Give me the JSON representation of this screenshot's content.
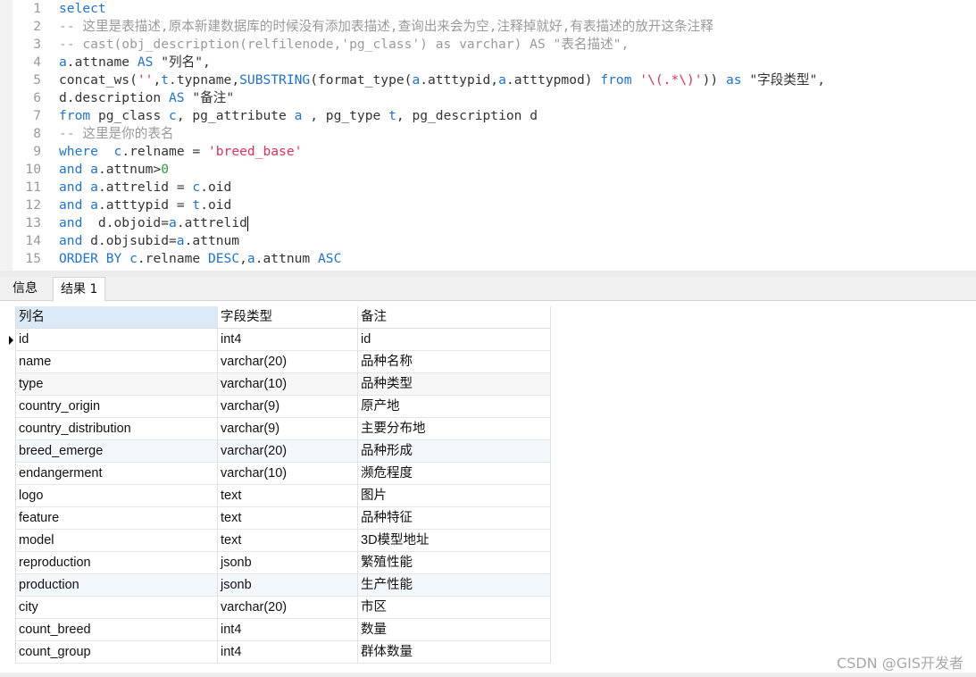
{
  "editor": {
    "lines": [
      [
        [
          "kw",
          "select"
        ]
      ],
      [
        [
          "cm",
          "-- 这里是表描述,原本新建数据库的时候没有添加表描述,查询出来会为空,注释掉就好,有表描述的放开这条注释"
        ]
      ],
      [
        [
          "cm",
          "-- cast(obj_description(relfilenode,'pg_class') as varchar) AS \"表名描述\","
        ]
      ],
      [
        [
          "kw",
          "a"
        ],
        [
          "",
          "."
        ],
        [
          "",
          "attname "
        ],
        [
          "kw",
          "AS"
        ],
        [
          "",
          " \"列名\","
        ]
      ],
      [
        [
          "",
          "concat_ws("
        ],
        [
          "str",
          "''"
        ],
        [
          "",
          ","
        ],
        [
          "kw",
          "t"
        ],
        [
          "",
          ".typname,"
        ],
        [
          "kw",
          "SUBSTRING"
        ],
        [
          "",
          "(format_type("
        ],
        [
          "kw",
          "a"
        ],
        [
          "",
          ".atttypid,"
        ],
        [
          "kw",
          "a"
        ],
        [
          "",
          ".atttypmod) "
        ],
        [
          "kw",
          "from"
        ],
        [
          "",
          " "
        ],
        [
          "str",
          "'\\(.*\\)'"
        ],
        [
          "",
          "))"
        ],
        [
          "",
          " "
        ],
        [
          "kw",
          "as"
        ],
        [
          "",
          " \"字段类型\","
        ]
      ],
      [
        [
          "",
          "d.description "
        ],
        [
          "kw",
          "AS"
        ],
        [
          "",
          " \"备注\""
        ]
      ],
      [
        [
          "kw",
          "from"
        ],
        [
          "",
          " pg_class "
        ],
        [
          "kw",
          "c"
        ],
        [
          "",
          ", pg_attribute "
        ],
        [
          "kw",
          "a"
        ],
        [
          "",
          " , pg_type "
        ],
        [
          "kw",
          "t"
        ],
        [
          "",
          ", pg_description d"
        ]
      ],
      [
        [
          "cm",
          "-- 这里是你的表名"
        ]
      ],
      [
        [
          "kw",
          "where"
        ],
        [
          "",
          "  "
        ],
        [
          "kw",
          "c"
        ],
        [
          "",
          ".relname = "
        ],
        [
          "str",
          "'breed_base'"
        ]
      ],
      [
        [
          "kw",
          "and"
        ],
        [
          "",
          " "
        ],
        [
          "kw",
          "a"
        ],
        [
          "",
          ".attnum>"
        ],
        [
          "num",
          "0"
        ]
      ],
      [
        [
          "kw",
          "and"
        ],
        [
          "",
          " "
        ],
        [
          "kw",
          "a"
        ],
        [
          "",
          ".attrelid = "
        ],
        [
          "kw",
          "c"
        ],
        [
          "",
          ".oid"
        ]
      ],
      [
        [
          "kw",
          "and"
        ],
        [
          "",
          " "
        ],
        [
          "kw",
          "a"
        ],
        [
          "",
          ".atttypid = "
        ],
        [
          "kw",
          "t"
        ],
        [
          "",
          ".oid"
        ]
      ],
      [
        [
          "kw",
          "and"
        ],
        [
          "",
          "  d.objoid="
        ],
        [
          "kw",
          "a"
        ],
        [
          "",
          ".attrelid"
        ],
        [
          "cursor",
          ""
        ]
      ],
      [
        [
          "kw",
          "and"
        ],
        [
          "",
          " d.objsubid="
        ],
        [
          "kw",
          "a"
        ],
        [
          "",
          ".attnum"
        ]
      ],
      [
        [
          "kw",
          "ORDER BY"
        ],
        [
          "",
          " "
        ],
        [
          "kw",
          "c"
        ],
        [
          "",
          ".relname "
        ],
        [
          "kw",
          "DESC"
        ],
        [
          "",
          ","
        ],
        [
          "kw",
          "a"
        ],
        [
          "",
          ".attnum "
        ],
        [
          "kw",
          "ASC"
        ]
      ],
      []
    ]
  },
  "tabs": [
    {
      "label": "信息"
    },
    {
      "label": "结果 1",
      "active": true
    }
  ],
  "grid": {
    "columns": [
      "列名",
      "字段类型",
      "备注"
    ],
    "rows": [
      [
        "id",
        "int4",
        "id"
      ],
      [
        "name",
        "varchar(20)",
        "品种名称"
      ],
      [
        "type",
        "varchar(10)",
        "品种类型"
      ],
      [
        "country_origin",
        "varchar(9)",
        "原产地"
      ],
      [
        "country_distribution",
        "varchar(9)",
        "主要分布地"
      ],
      [
        "breed_emerge",
        "varchar(20)",
        "品种形成"
      ],
      [
        "endangerment",
        "varchar(10)",
        "濒危程度"
      ],
      [
        "logo",
        "text",
        "图片"
      ],
      [
        "feature",
        "text",
        "品种特征"
      ],
      [
        "model",
        "text",
        "3D模型地址"
      ],
      [
        "reproduction",
        "jsonb",
        "繁殖性能"
      ],
      [
        "production",
        "jsonb",
        "生产性能"
      ],
      [
        "city",
        "varchar(20)",
        "市区"
      ],
      [
        "count_breed",
        "int4",
        "数量"
      ],
      [
        "count_group",
        "int4",
        "群体数量"
      ]
    ]
  },
  "watermark": "CSDN @GIS开发者",
  "colors": {
    "keyword": "#1f73c8",
    "string": "#d7335b",
    "comment": "#9a9a9a",
    "number": "#2a9d3a",
    "header_selected": "#dbe9f7"
  }
}
